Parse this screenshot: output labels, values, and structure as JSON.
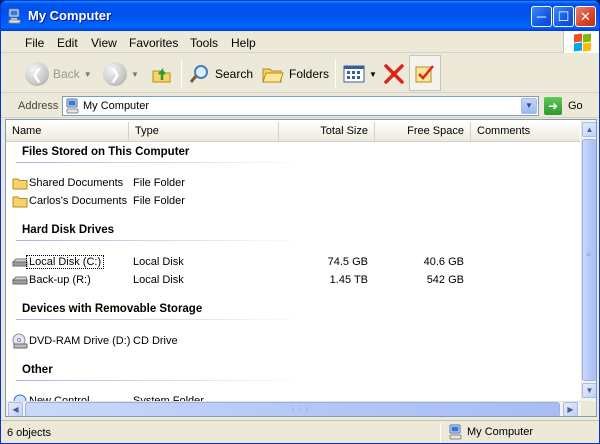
{
  "window": {
    "title": "My Computer"
  },
  "menu": [
    "File",
    "Edit",
    "View",
    "Favorites",
    "Tools",
    "Help"
  ],
  "toolbar": {
    "back": "Back",
    "search": "Search",
    "folders": "Folders"
  },
  "address": {
    "label": "Address",
    "value": "My Computer",
    "go": "Go"
  },
  "columns": {
    "name": "Name",
    "type": "Type",
    "total": "Total Size",
    "free": "Free Space",
    "comments": "Comments"
  },
  "groups": [
    {
      "title": "Files Stored on This Computer",
      "items": [
        {
          "name": "Shared Documents",
          "type": "File Folder",
          "total": "",
          "free": ""
        },
        {
          "name": "Carlos's Documents",
          "type": "File Folder",
          "total": "",
          "free": ""
        }
      ]
    },
    {
      "title": "Hard Disk Drives",
      "items": [
        {
          "name": "Local Disk (C:)",
          "type": "Local Disk",
          "total": "74.5 GB",
          "free": "40.6 GB"
        },
        {
          "name": "Back-up (R:)",
          "type": "Local Disk",
          "total": "1.45 TB",
          "free": "542 GB"
        }
      ]
    },
    {
      "title": "Devices with Removable Storage",
      "items": [
        {
          "name": "DVD-RAM Drive (D:)",
          "type": "CD Drive",
          "total": "",
          "free": ""
        }
      ]
    },
    {
      "title": "Other",
      "items": [
        {
          "name": "New Control",
          "type": "System Folder",
          "total": "",
          "free": ""
        }
      ]
    }
  ],
  "status": {
    "count": "6 objects",
    "location": "My Computer"
  }
}
